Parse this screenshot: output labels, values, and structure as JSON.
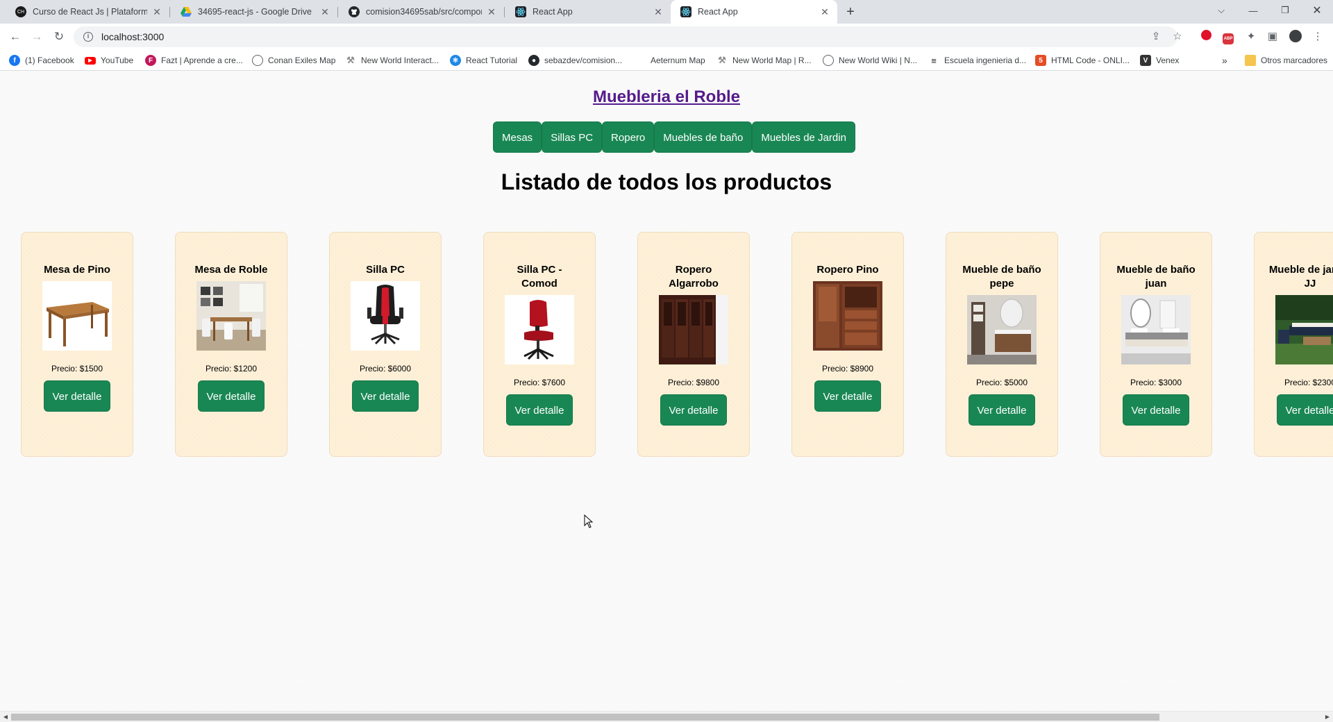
{
  "browser": {
    "tabs": [
      {
        "title": "Curso de React Js | Plataforma el...",
        "icon": "coder-icon",
        "active": false
      },
      {
        "title": "34695-react-js - Google Drive",
        "icon": "google-drive-icon",
        "active": false
      },
      {
        "title": "comision34695sab/src/compone...",
        "icon": "github-icon",
        "active": false
      },
      {
        "title": "React App",
        "icon": "react-icon",
        "active": false
      },
      {
        "title": "React App",
        "icon": "react-icon",
        "active": true
      }
    ],
    "new_tab_label": "+",
    "address": "localhost:3000",
    "bookmarks": [
      {
        "label": "(1) Facebook",
        "icon": "facebook-icon",
        "color": "#1877f2"
      },
      {
        "label": "YouTube",
        "icon": "youtube-icon",
        "color": "#ff0000"
      },
      {
        "label": "Fazt | Aprende a cre...",
        "icon": "fazt-icon",
        "color": "#c2185b"
      },
      {
        "label": "Conan Exiles Map",
        "icon": "globe-icon",
        "color": "#5f6368"
      },
      {
        "label": "New World Interact...",
        "icon": "newworld-icon",
        "color": "#8d8d8d"
      },
      {
        "label": "React Tutorial",
        "icon": "react-tutorial-icon",
        "color": "#1e88e5"
      },
      {
        "label": "sebazdev/comision...",
        "icon": "github-icon",
        "color": "#24292e"
      },
      {
        "label": "Aeternum Map",
        "icon": "map-icon",
        "color": "#ffffff"
      },
      {
        "label": "New World Map | R...",
        "icon": "newworld-icon",
        "color": "#8d8d8d"
      },
      {
        "label": "New World Wiki | N...",
        "icon": "globe-icon",
        "color": "#5f6368"
      },
      {
        "label": "Escuela ingenieria d...",
        "icon": "escuela-icon",
        "color": "#202124"
      },
      {
        "label": "HTML Code - ONLI...",
        "icon": "html-code-icon",
        "color": "#e44d26"
      },
      {
        "label": "Venex",
        "icon": "venex-icon",
        "color": "#333333"
      }
    ],
    "more_bookmarks": "»",
    "other_bookmarks": "Otros marcadores"
  },
  "site": {
    "brand": "Muebleria el Roble",
    "categories": [
      "Mesas",
      "Sillas PC",
      "Ropero",
      "Muebles de baño",
      "Muebles de Jardin"
    ],
    "heading": "Listado de todos los productos",
    "detail_label": "Ver detalle",
    "products": [
      {
        "name": "Mesa de Pino",
        "price": "Precio: $1500",
        "image": "wooden-table"
      },
      {
        "name": "Mesa de Roble",
        "price": "Precio: $1200",
        "image": "dining-room"
      },
      {
        "name": "Silla PC",
        "price": "Precio: $6000",
        "image": "gaming-chair"
      },
      {
        "name": "Silla PC - Comod",
        "price": "Precio: $7600",
        "image": "office-chair"
      },
      {
        "name": "Ropero Algarrobo",
        "price": "Precio: $9800",
        "image": "dark-wardrobe"
      },
      {
        "name": "Ropero Pino",
        "price": "Precio: $8900",
        "image": "wood-wardrobe"
      },
      {
        "name": "Mueble de baño pepe",
        "price": "Precio: $5000",
        "image": "bathroom-vanity"
      },
      {
        "name": "Mueble de baño juan",
        "price": "Precio: $3000",
        "image": "bathroom-sink"
      },
      {
        "name": "Mueble de jardin JJ",
        "price": "Precio: $2300",
        "image": "garden-furniture"
      }
    ]
  },
  "colors": {
    "primary_button": "#198754",
    "card_background": "#fdeed3",
    "brand_link": "#551a8b"
  }
}
